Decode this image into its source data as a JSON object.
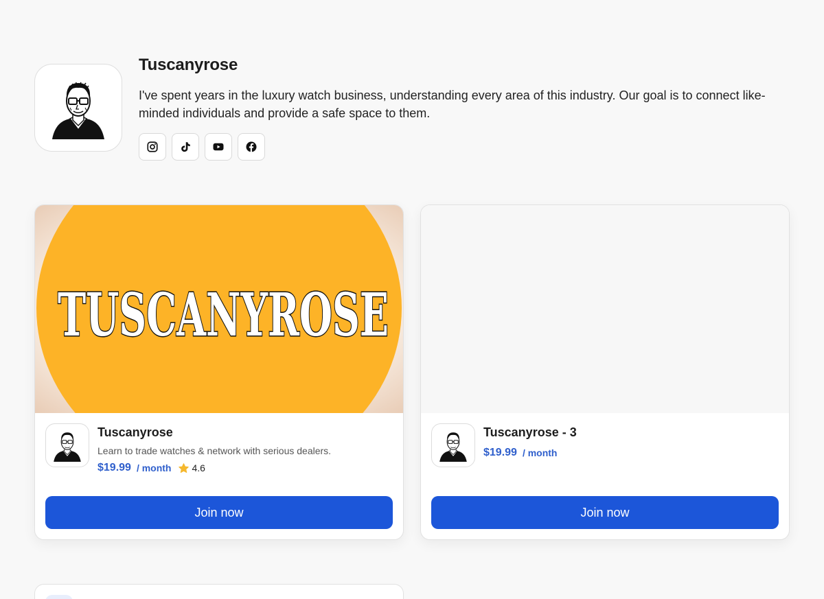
{
  "profile": {
    "name": "Tuscanyrose",
    "bio": "I've spent years in the luxury watch business, understanding every area of this industry. Our goal is to connect like-minded individuals and provide a safe space to them.",
    "socials": [
      {
        "icon": "instagram-icon"
      },
      {
        "icon": "tiktok-icon"
      },
      {
        "icon": "youtube-icon"
      },
      {
        "icon": "facebook-icon"
      }
    ]
  },
  "cards": [
    {
      "banner_text": "TUSCANYROSE",
      "title": "Tuscanyrose",
      "description": "Learn to trade watches & network with serious dealers.",
      "price": "$19.99",
      "period": "/ month",
      "rating": "4.6",
      "button": "Join now"
    },
    {
      "title": "Tuscanyrose - 3",
      "price": "$19.99",
      "period": "/ month",
      "button": "Join now"
    }
  ],
  "colors": {
    "accent": "#1c56d9",
    "price": "#2f5fcc",
    "banner": "#fdb327",
    "star": "#f5b82e"
  }
}
